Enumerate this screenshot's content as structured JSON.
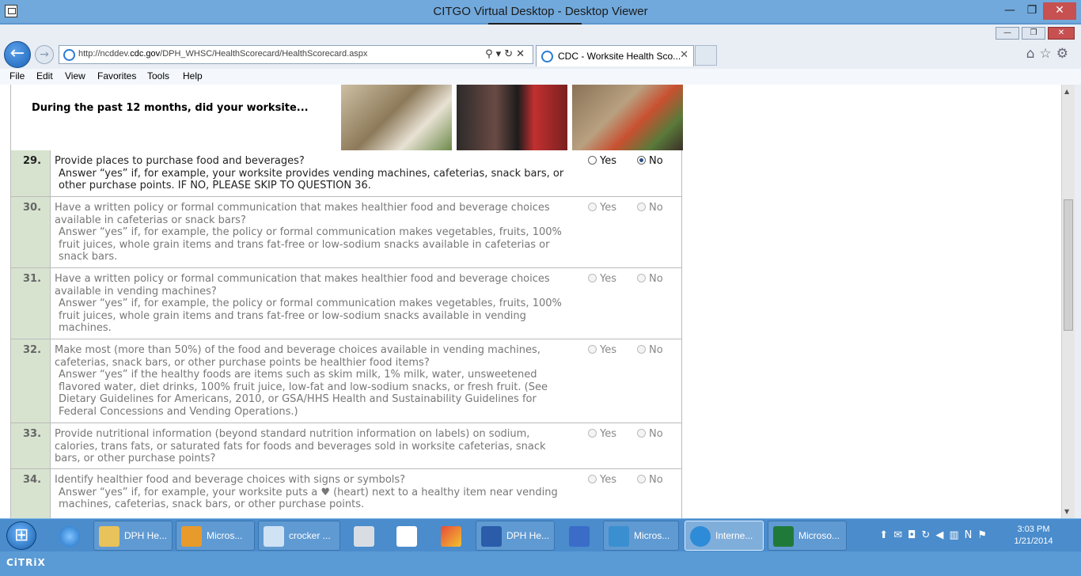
{
  "outer_window": {
    "title": "CITGO Virtual Desktop - Desktop Viewer"
  },
  "browser": {
    "url_prefix": "http://ncddev.",
    "url_domain": "cdc.gov",
    "url_path": "/DPH_WHSC/HealthScorecard/HealthScorecard.aspx",
    "tab_title": "CDC - Worksite Health Sco...",
    "menu": [
      "File",
      "Edit",
      "View",
      "Favorites",
      "Tools",
      "Help"
    ]
  },
  "page": {
    "section_question": "During the past 12 months, did your worksite...",
    "yes_label": "Yes",
    "no_label": "No",
    "questions": [
      {
        "num": "29.",
        "text": "Provide places to purchase food and beverages?",
        "hint": "Answer “yes” if, for example, your worksite provides vending machines, cafeterias, snack bars, or other purchase points. IF NO, PLEASE SKIP TO QUESTION 36.",
        "selected": "No",
        "enabled": true
      },
      {
        "num": "30.",
        "text": "Have a written policy or formal communication that makes healthier food and beverage choices available in cafeterias or snack bars?",
        "hint": "Answer “yes” if, for example, the policy or formal communication makes vegetables, fruits, 100% fruit juices, whole grain items and trans fat-free or low-sodium snacks available in cafeterias or snack bars.",
        "selected": "",
        "enabled": false
      },
      {
        "num": "31.",
        "text": "Have a written policy or formal communication that makes healthier food and beverage choices available in vending machines?",
        "hint": "Answer “yes” if, for example, the policy or formal communication makes vegetables, fruits, 100% fruit juices, whole grain items and trans fat-free or low-sodium snacks available in vending machines.",
        "selected": "",
        "enabled": false
      },
      {
        "num": "32.",
        "text": "Make most (more than 50%) of the food and beverage choices available in vending machines, cafeterias, snack bars, or other purchase points be healthier food items?",
        "hint": "Answer “yes” if the healthy foods are items such as skim milk, 1% milk, water, unsweetened flavored water, diet drinks, 100% fruit juice, low-fat and low-sodium snacks, or fresh fruit. (See Dietary Guidelines for Americans, 2010, or GSA/HHS Health and Sustainability Guidelines for Federal Concessions and Vending Operations.)",
        "selected": "",
        "enabled": false
      },
      {
        "num": "33.",
        "text": "Provide nutritional information (beyond standard nutrition information on labels) on sodium, calories, trans fats, or saturated fats for foods and beverages sold in worksite cafeterias, snack bars, or other purchase points?",
        "hint": "",
        "selected": "",
        "enabled": false
      },
      {
        "num": "34.",
        "text": "Identify healthier food and beverage choices with signs or symbols?",
        "hint": "Answer “yes” if, for example, your worksite puts a ♥ (heart) next to a healthy item near vending machines, cafeterias, snack bars, or other purchase points.",
        "selected": "",
        "enabled": false
      }
    ]
  },
  "taskbar": {
    "items": [
      {
        "label": "DPH He...",
        "icon": "folder-icon",
        "color": "#e8c25a"
      },
      {
        "label": "Micros...",
        "icon": "outlook-icon",
        "color": "#e89a2a"
      },
      {
        "label": "crocker ...",
        "icon": "notepad-icon",
        "color": "#cfe3f5"
      },
      {
        "label": "DPH He...",
        "icon": "word-icon",
        "color": "#2a5caa"
      },
      {
        "label": "Micros...",
        "icon": "lync-icon",
        "color": "#3a8fd0"
      },
      {
        "label": "Interne...",
        "icon": "ie-icon",
        "color": "#2e8bd8"
      },
      {
        "label": "Microso...",
        "icon": "excel-icon",
        "color": "#1f7a3a"
      }
    ],
    "time": "3:03 PM",
    "date": "1/21/2014"
  },
  "citrix": {
    "brand": "CiTRiX"
  }
}
